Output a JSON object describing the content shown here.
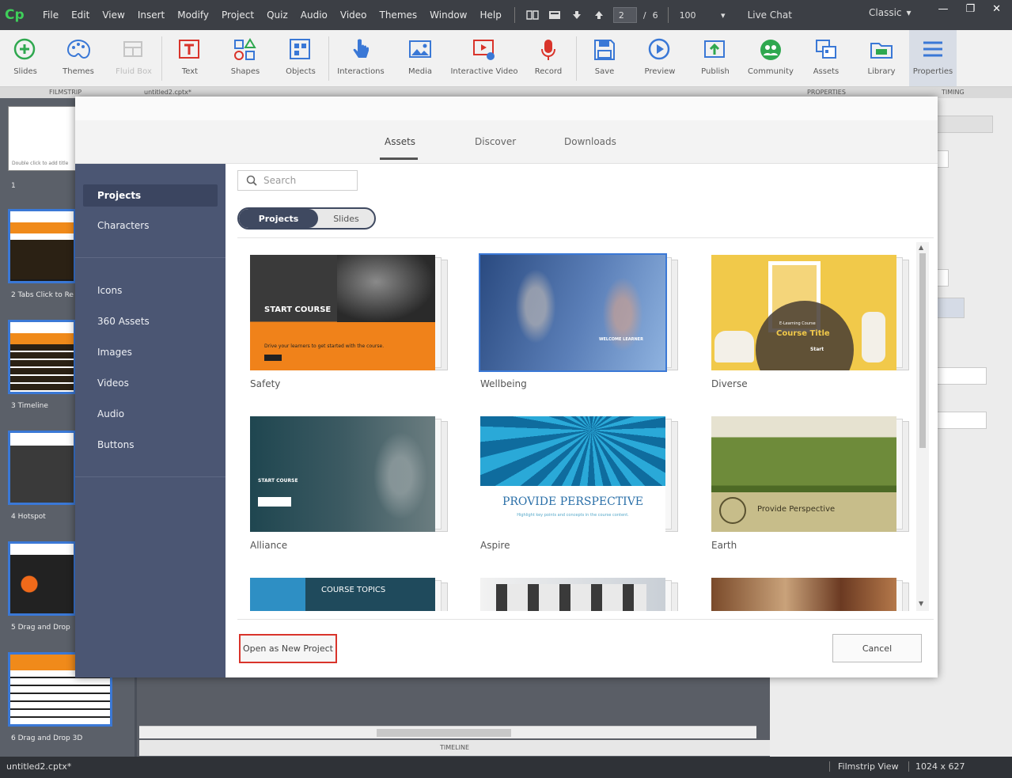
{
  "app": {
    "logo": "Cp",
    "menu": [
      "File",
      "Edit",
      "View",
      "Insert",
      "Modify",
      "Project",
      "Quiz",
      "Audio",
      "Video",
      "Themes",
      "Window",
      "Help"
    ],
    "slide_current": "2",
    "slide_sep": "/",
    "slide_total": "6",
    "zoom": "100",
    "live_chat": "Live Chat",
    "workspace": "Classic",
    "win_minimize": "—",
    "win_restore": "❐",
    "win_close": "✕"
  },
  "toolbar": [
    {
      "id": "slides",
      "label": "Slides"
    },
    {
      "id": "themes",
      "label": "Themes"
    },
    {
      "id": "fluid",
      "label": "Fluid Box"
    },
    {
      "id": "text",
      "label": "Text"
    },
    {
      "id": "shapes",
      "label": "Shapes"
    },
    {
      "id": "objects",
      "label": "Objects"
    },
    {
      "id": "interactions",
      "label": "Interactions"
    },
    {
      "id": "media",
      "label": "Media"
    },
    {
      "id": "ivideo",
      "label": "Interactive Video"
    },
    {
      "id": "record",
      "label": "Record"
    },
    {
      "id": "save",
      "label": "Save"
    },
    {
      "id": "preview",
      "label": "Preview"
    },
    {
      "id": "publish",
      "label": "Publish"
    },
    {
      "id": "community",
      "label": "Community"
    },
    {
      "id": "assets",
      "label": "Assets"
    },
    {
      "id": "library",
      "label": "Library"
    },
    {
      "id": "properties",
      "label": "Properties"
    }
  ],
  "substrip": {
    "filmstrip": "FILMSTRIP",
    "file_tab": "untitled2.cptx*",
    "properties": "PROPERTIES",
    "timing": "TIMING"
  },
  "filmstrip": {
    "slide1_hint": "Double click to add title",
    "slides": [
      {
        "num": "1",
        "label": ""
      },
      {
        "num": "2",
        "label": "2 Tabs Click to Re"
      },
      {
        "num": "3",
        "label": "3 Timeline"
      },
      {
        "num": "4",
        "label": "4 Hotspot"
      },
      {
        "num": "5",
        "label": "5 Drag and Drop"
      },
      {
        "num": "6",
        "label": "6 Drag and Drop 3D"
      }
    ]
  },
  "dialog": {
    "tabs": [
      "Assets",
      "Discover",
      "Downloads"
    ],
    "active_tab": "Assets",
    "sidebar": [
      "Projects",
      "Characters",
      "Icons",
      "360 Assets",
      "Images",
      "Videos",
      "Audio",
      "Buttons"
    ],
    "active_sidebar": "Projects",
    "search_placeholder": "Search",
    "segment": {
      "a": "Projects",
      "b": "Slides"
    },
    "cards": [
      {
        "name": "Safety",
        "heading": "START COURSE",
        "sub": "Drive your learners to get started with the course."
      },
      {
        "name": "Wellbeing",
        "heading": "WELCOME LEARNER",
        "sub": ""
      },
      {
        "name": "Diverse",
        "heading": "Course Title",
        "sub": "E-Learning Course",
        "btn": "Start"
      },
      {
        "name": "Alliance",
        "heading": "START COURSE",
        "sub": ""
      },
      {
        "name": "Aspire",
        "heading": "PROVIDE PERSPECTIVE",
        "sub": "Highlight key points and concepts in the course content."
      },
      {
        "name": "Earth",
        "heading": "Provide Perspective",
        "sub": ""
      },
      {
        "name": "Course Topics",
        "heading": "COURSE TOPICS",
        "sub": ""
      },
      {
        "name": "",
        "heading": "",
        "sub": ""
      },
      {
        "name": "",
        "heading": "",
        "sub": ""
      }
    ],
    "open_button": "Open as New Project",
    "cancel_button": "Cancel"
  },
  "timeline_label": "TIMELINE",
  "status": {
    "file": "untitled2.cptx*",
    "view": "Filmstrip View",
    "size": "1024 x 627"
  }
}
